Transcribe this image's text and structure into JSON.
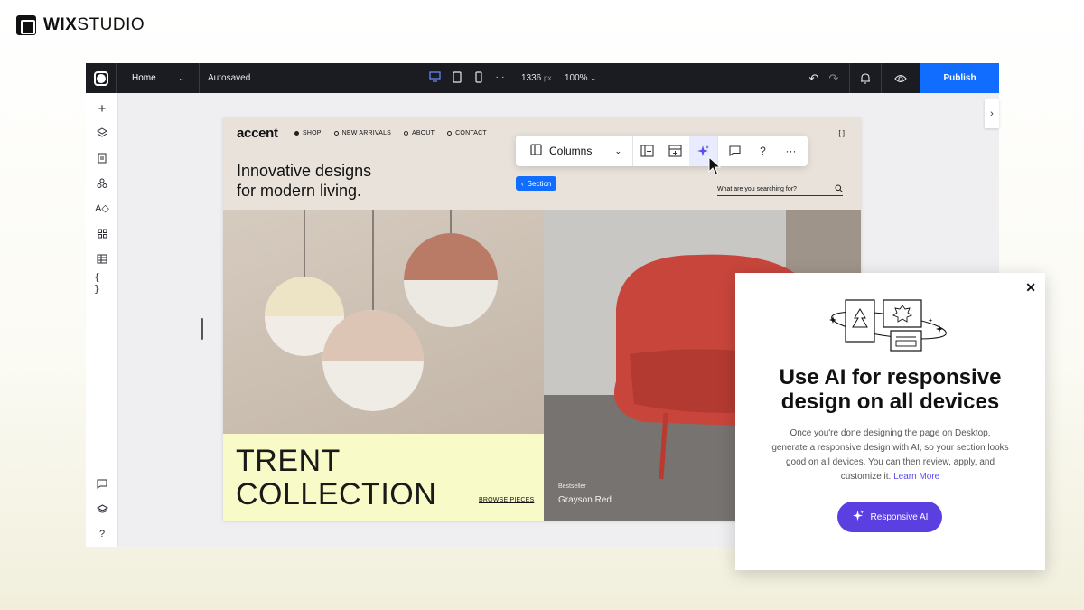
{
  "brand": {
    "name_bold": "WIX",
    "name_rest": "STUDIO"
  },
  "topbar": {
    "page": "Home",
    "autosave": "Autosaved",
    "width_value": "1336",
    "width_unit": "px",
    "zoom": "100%",
    "more": "···",
    "publish": "Publish"
  },
  "site": {
    "logo": "accent",
    "nav": [
      "SHOP",
      "NEW ARRIVALS",
      "ABOUT",
      "CONTACT"
    ],
    "expand": "[ ]",
    "headline_line1": "Innovative designs",
    "headline_line2": "for modern living.",
    "search_placeholder": "What are you searching for?",
    "section_badge": "Section",
    "collection_line1": "TRENT",
    "collection_line2": "COLLECTION",
    "browse": "BROWSE PIECES",
    "bestseller": "Bestseller",
    "product_name": "Grayson Red"
  },
  "toolbar": {
    "columns_label": "Columns",
    "help": "?",
    "more": "···"
  },
  "modal": {
    "close": "✕",
    "title_line1": "Use AI for responsive",
    "title_line2": "design on all devices",
    "body": "Once you're done designing the page on Desktop, generate a responsive design with AI, so your section looks good on all devices. You can then review, apply, and customize it.",
    "link": "Learn More",
    "cta": "Responsive AI"
  },
  "colors": {
    "accent_blue": "#116dff",
    "ai_purple": "#5b3fe0",
    "topbar": "#1b1c22",
    "collection_bg": "#f8fbc7"
  }
}
